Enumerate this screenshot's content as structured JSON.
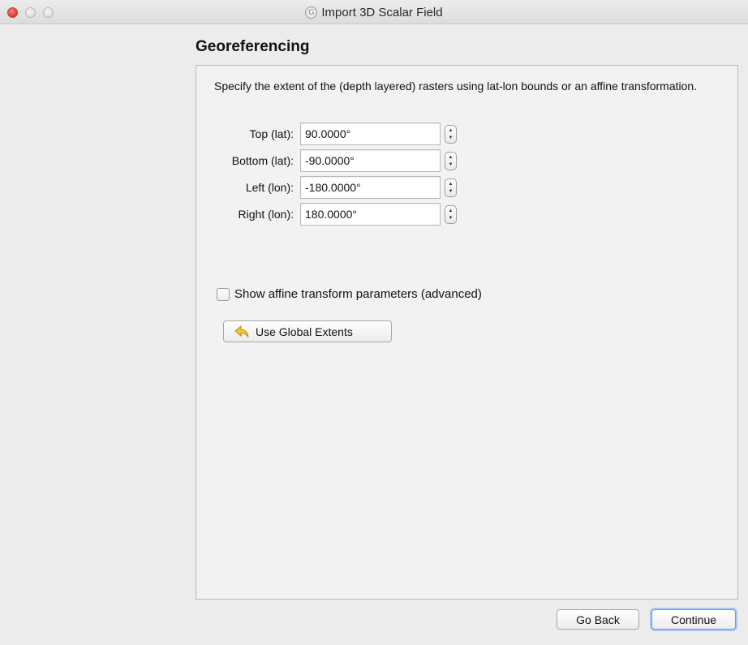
{
  "window": {
    "title": "Import 3D Scalar Field",
    "app_icon": "gplates-icon"
  },
  "page": {
    "title": "Georeferencing",
    "description": "Specify the extent of the (depth layered) rasters using lat-lon bounds or an affine transformation."
  },
  "fields": [
    {
      "label": "Top (lat):",
      "value": "90.0000°"
    },
    {
      "label": "Bottom (lat):",
      "value": "-90.0000°"
    },
    {
      "label": "Left (lon):",
      "value": "-180.0000°"
    },
    {
      "label": "Right (lon):",
      "value": "180.0000°"
    }
  ],
  "affine_checkbox": {
    "label": "Show affine transform parameters (advanced)",
    "checked": false
  },
  "global_extents_button": {
    "label": "Use Global Extents",
    "icon": "undo-arrow-icon"
  },
  "footer": {
    "back_label": "Go Back",
    "continue_label": "Continue"
  }
}
